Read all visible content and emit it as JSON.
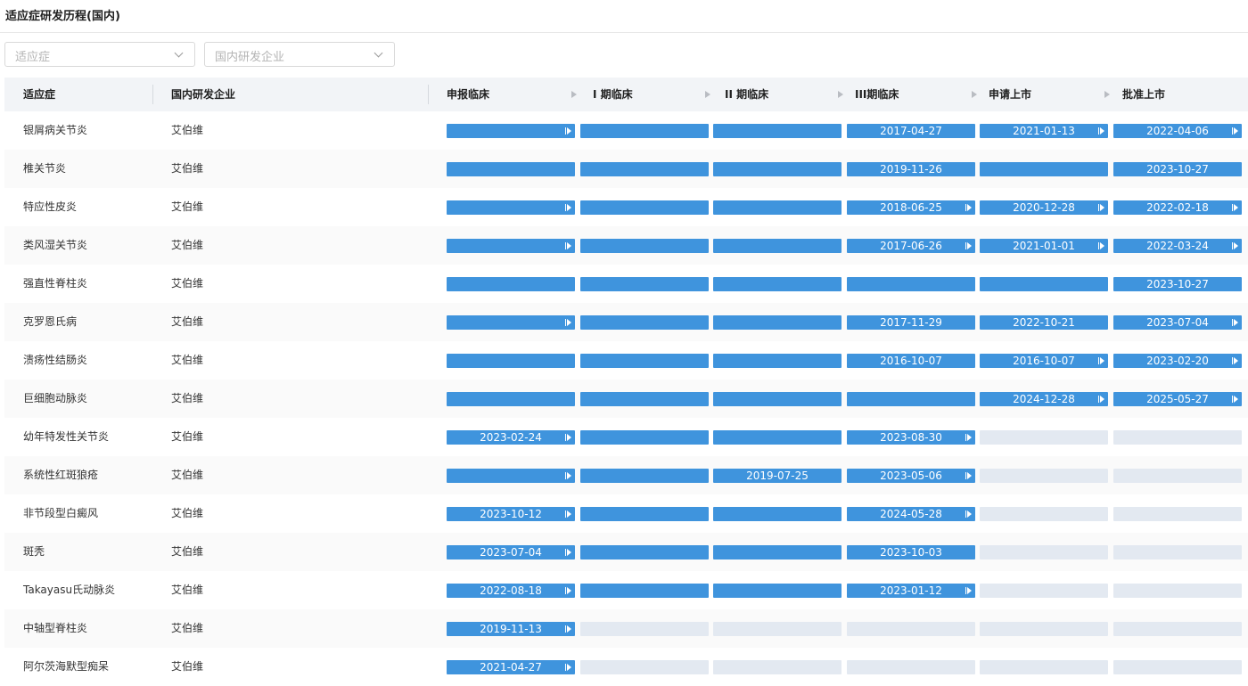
{
  "page": {
    "title": "适应症研发历程(国内)"
  },
  "filters": {
    "indication": {
      "placeholder": "适应症"
    },
    "company": {
      "placeholder": "国内研发企业"
    }
  },
  "table": {
    "headers": [
      "适应症",
      "国内研发企业",
      "申报临床",
      "I 期临床",
      "II 期临床",
      "III期临床",
      "申请上市",
      "批准上市"
    ],
    "rows": [
      {
        "indication": "银屑病关节炎",
        "company": "艾伯维",
        "stages": [
          {
            "state": "filled",
            "marker": true
          },
          {
            "state": "filled"
          },
          {
            "state": "filled"
          },
          {
            "state": "filled",
            "date": "2017-04-27"
          },
          {
            "state": "filled",
            "date": "2021-01-13",
            "marker": true
          },
          {
            "state": "filled",
            "date": "2022-04-06",
            "marker": true
          }
        ]
      },
      {
        "indication": "椎关节炎",
        "company": "艾伯维",
        "stages": [
          {
            "state": "filled"
          },
          {
            "state": "filled"
          },
          {
            "state": "filled"
          },
          {
            "state": "filled",
            "date": "2019-11-26"
          },
          {
            "state": "filled"
          },
          {
            "state": "filled",
            "date": "2023-10-27"
          }
        ]
      },
      {
        "indication": "特应性皮炎",
        "company": "艾伯维",
        "stages": [
          {
            "state": "filled",
            "marker": true
          },
          {
            "state": "filled"
          },
          {
            "state": "filled"
          },
          {
            "state": "filled",
            "date": "2018-06-25",
            "marker": true
          },
          {
            "state": "filled",
            "date": "2020-12-28",
            "marker": true
          },
          {
            "state": "filled",
            "date": "2022-02-18",
            "marker": true
          }
        ]
      },
      {
        "indication": "类风湿关节炎",
        "company": "艾伯维",
        "stages": [
          {
            "state": "filled",
            "marker": true
          },
          {
            "state": "filled"
          },
          {
            "state": "filled"
          },
          {
            "state": "filled",
            "date": "2017-06-26",
            "marker": true
          },
          {
            "state": "filled",
            "date": "2021-01-01",
            "marker": true
          },
          {
            "state": "filled",
            "date": "2022-03-24",
            "marker": true
          }
        ]
      },
      {
        "indication": "强直性脊柱炎",
        "company": "艾伯维",
        "stages": [
          {
            "state": "filled"
          },
          {
            "state": "filled"
          },
          {
            "state": "filled"
          },
          {
            "state": "filled"
          },
          {
            "state": "filled"
          },
          {
            "state": "filled",
            "date": "2023-10-27"
          }
        ]
      },
      {
        "indication": "克罗恩氏病",
        "company": "艾伯维",
        "stages": [
          {
            "state": "filled",
            "marker": true
          },
          {
            "state": "filled"
          },
          {
            "state": "filled"
          },
          {
            "state": "filled",
            "date": "2017-11-29"
          },
          {
            "state": "filled",
            "date": "2022-10-21"
          },
          {
            "state": "filled",
            "date": "2023-07-04",
            "marker": true
          }
        ]
      },
      {
        "indication": "溃疡性结肠炎",
        "company": "艾伯维",
        "stages": [
          {
            "state": "filled"
          },
          {
            "state": "filled"
          },
          {
            "state": "filled"
          },
          {
            "state": "filled",
            "date": "2016-10-07"
          },
          {
            "state": "filled",
            "date": "2016-10-07",
            "marker": true
          },
          {
            "state": "filled",
            "date": "2023-02-20",
            "marker": true
          }
        ]
      },
      {
        "indication": "巨细胞动脉炎",
        "company": "艾伯维",
        "stages": [
          {
            "state": "filled"
          },
          {
            "state": "filled"
          },
          {
            "state": "filled"
          },
          {
            "state": "filled"
          },
          {
            "state": "filled",
            "date": "2024-12-28",
            "marker": true
          },
          {
            "state": "filled",
            "date": "2025-05-27",
            "marker": true
          }
        ]
      },
      {
        "indication": "幼年特发性关节炎",
        "company": "艾伯维",
        "stages": [
          {
            "state": "filled",
            "date": "2023-02-24",
            "marker": true
          },
          {
            "state": "filled"
          },
          {
            "state": "filled"
          },
          {
            "state": "filled",
            "date": "2023-08-30",
            "marker": true
          },
          {
            "state": "empty"
          },
          {
            "state": "empty"
          }
        ]
      },
      {
        "indication": "系统性红斑狼疮",
        "company": "艾伯维",
        "stages": [
          {
            "state": "filled",
            "marker": true
          },
          {
            "state": "filled"
          },
          {
            "state": "filled",
            "date": "2019-07-25"
          },
          {
            "state": "filled",
            "date": "2023-05-06",
            "marker": true
          },
          {
            "state": "empty"
          },
          {
            "state": "empty"
          }
        ]
      },
      {
        "indication": "非节段型白癜风",
        "company": "艾伯维",
        "stages": [
          {
            "state": "filled",
            "date": "2023-10-12",
            "marker": true
          },
          {
            "state": "filled"
          },
          {
            "state": "filled"
          },
          {
            "state": "filled",
            "date": "2024-05-28",
            "marker": true
          },
          {
            "state": "empty"
          },
          {
            "state": "empty"
          }
        ]
      },
      {
        "indication": "斑秃",
        "company": "艾伯维",
        "stages": [
          {
            "state": "filled",
            "date": "2023-07-04",
            "marker": true
          },
          {
            "state": "filled"
          },
          {
            "state": "filled"
          },
          {
            "state": "filled",
            "date": "2023-10-03"
          },
          {
            "state": "empty"
          },
          {
            "state": "empty"
          }
        ]
      },
      {
        "indication": "Takayasu氏动脉炎",
        "company": "艾伯维",
        "stages": [
          {
            "state": "filled",
            "date": "2022-08-18",
            "marker": true
          },
          {
            "state": "filled"
          },
          {
            "state": "filled"
          },
          {
            "state": "filled",
            "date": "2023-01-12",
            "marker": true
          },
          {
            "state": "empty"
          },
          {
            "state": "empty"
          }
        ]
      },
      {
        "indication": "中轴型脊柱炎",
        "company": "艾伯维",
        "stages": [
          {
            "state": "filled",
            "date": "2019-11-13",
            "marker": true
          },
          {
            "state": "empty"
          },
          {
            "state": "empty"
          },
          {
            "state": "empty"
          },
          {
            "state": "empty"
          },
          {
            "state": "empty"
          }
        ]
      },
      {
        "indication": "阿尔茨海默型痴呆",
        "company": "艾伯维",
        "stages": [
          {
            "state": "filled",
            "date": "2021-04-27",
            "marker": true
          },
          {
            "state": "empty"
          },
          {
            "state": "empty"
          },
          {
            "state": "empty"
          },
          {
            "state": "empty"
          },
          {
            "state": "empty"
          }
        ]
      }
    ]
  },
  "colors": {
    "filled_bar": "#3f94dd",
    "empty_bar": "#e3e9f1",
    "header_bg": "#f2f4f7"
  }
}
